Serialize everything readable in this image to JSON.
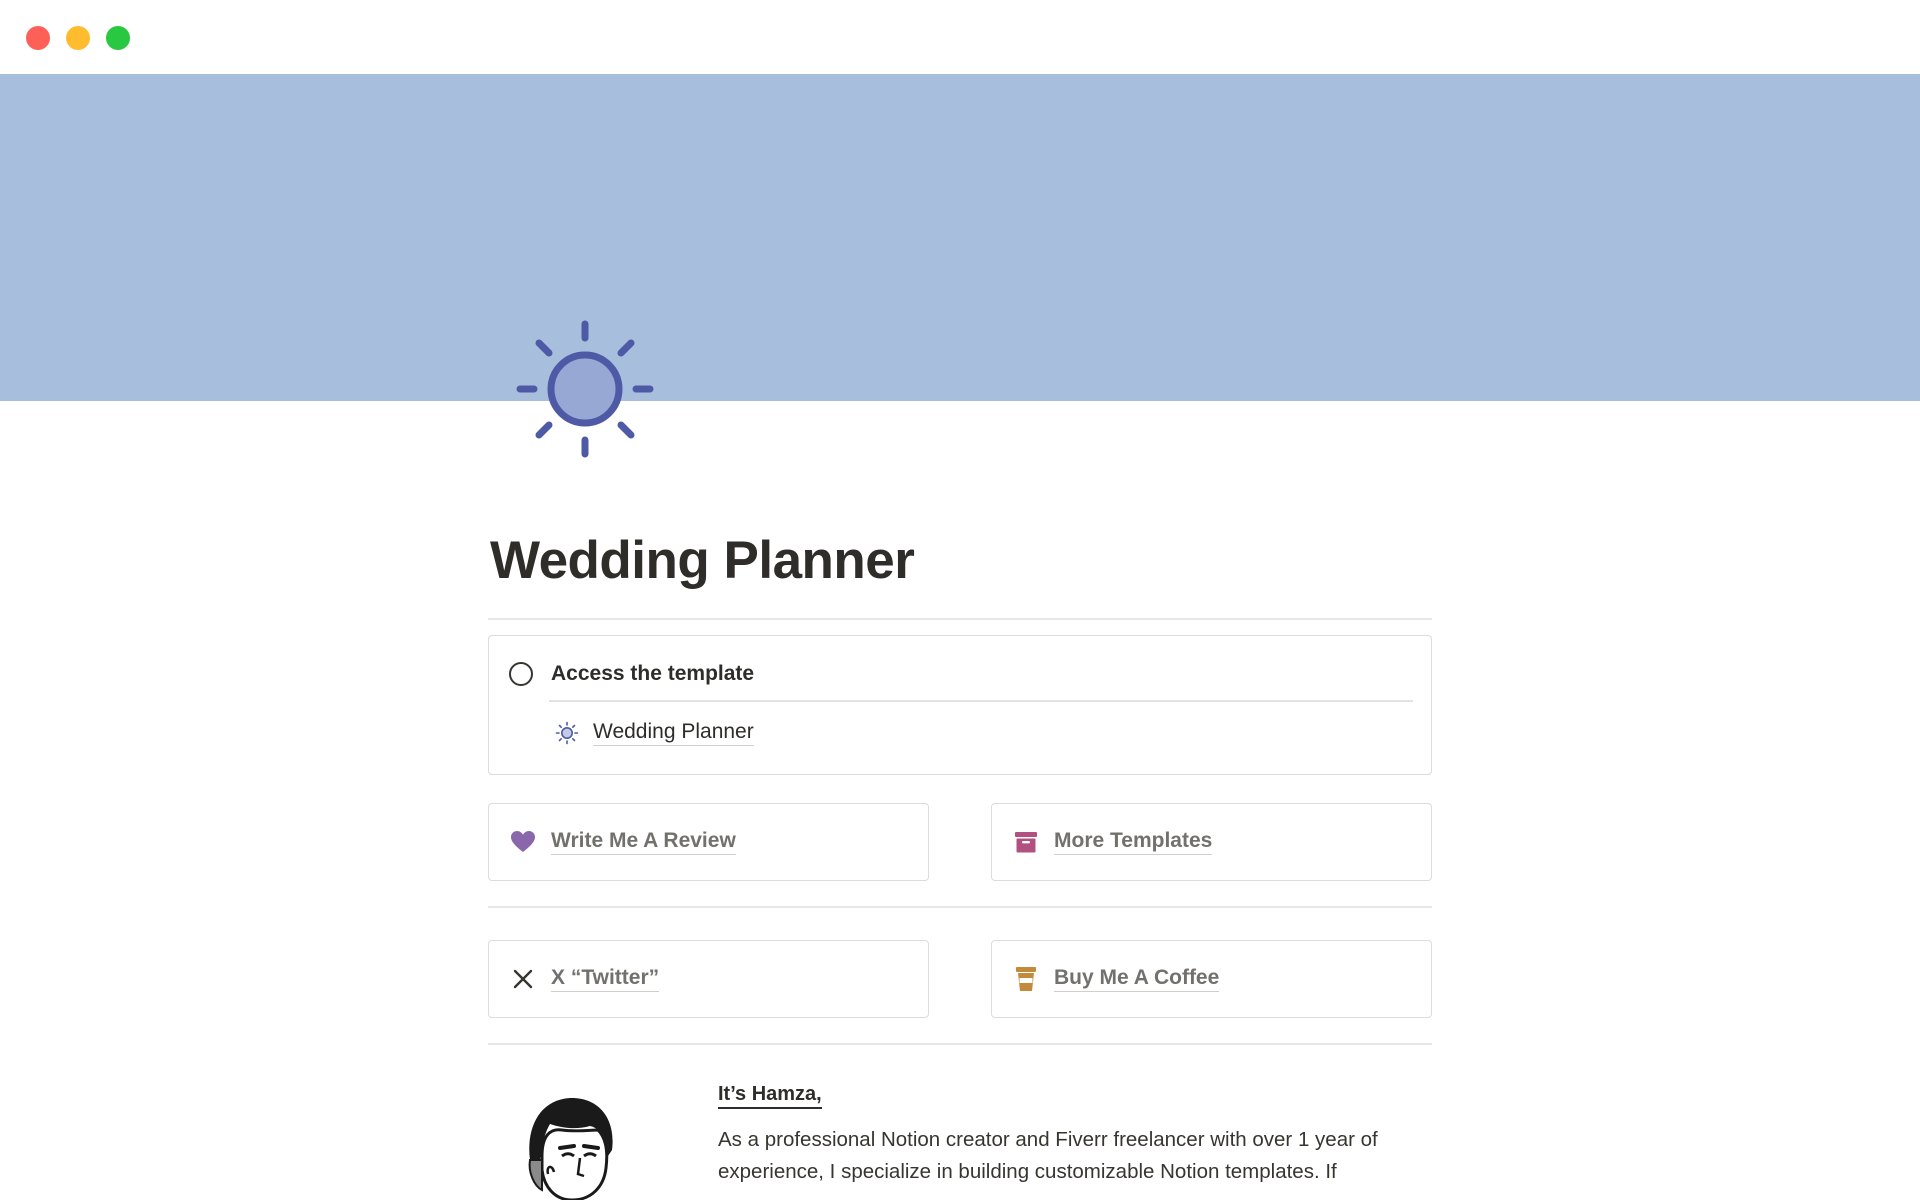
{
  "window": {
    "controls": [
      "close",
      "minimize",
      "maximize"
    ],
    "colors": {
      "close": "#fe5f57",
      "minimize": "#febc2e",
      "maximize": "#28c840"
    }
  },
  "cover": {
    "color": "#a7bedd"
  },
  "page": {
    "icon": "sun-icon",
    "title": "Wedding Planner"
  },
  "callout": {
    "todo_label": "Access the template",
    "todo_checked": false,
    "sub_item": {
      "icon": "sun-icon",
      "label": "Wedding Planner"
    }
  },
  "buttons": {
    "review": {
      "label": "Write Me A Review",
      "icon": "heart-icon",
      "color": "#8a67ab"
    },
    "templates": {
      "label": "More Templates",
      "icon": "archive-box-icon",
      "color": "#b0517f"
    },
    "twitter": {
      "label": "X “Twitter”",
      "icon": "x-icon",
      "color": "#37352f"
    },
    "coffee": {
      "label": "Buy Me A Coffee",
      "icon": "coffee-cup-icon",
      "color": "#c28a3a"
    }
  },
  "bio": {
    "heading": "It’s Hamza,",
    "text": "As a professional Notion creator and Fiverr freelancer with over 1 year of experience, I specialize in building customizable Notion templates. If"
  },
  "accent": "#4f5aa6"
}
